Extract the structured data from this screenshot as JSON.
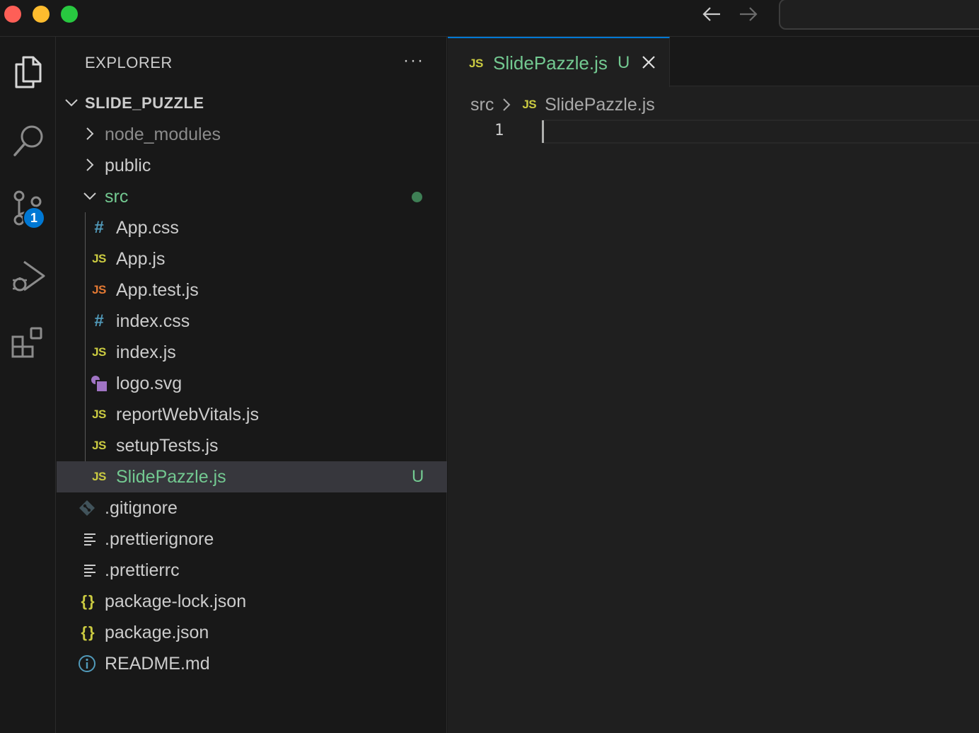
{
  "window": {
    "traffic_lights": {
      "close": "#fe5f57",
      "minimize": "#febc2e",
      "maximize": "#28c840"
    }
  },
  "activity_bar": {
    "items": [
      {
        "icon": "files-icon"
      },
      {
        "icon": "search-icon"
      },
      {
        "icon": "source-control-icon",
        "badge": "1"
      },
      {
        "icon": "run-debug-icon"
      },
      {
        "icon": "extensions-icon"
      }
    ]
  },
  "sidebar": {
    "title": "EXPLORER",
    "more_actions": "···",
    "folder": "SLIDE_PUZZLE",
    "tree": [
      {
        "label": "node_modules",
        "type": "folder",
        "expanded": false,
        "color": "#8b8b8b"
      },
      {
        "label": "public",
        "type": "folder",
        "expanded": false,
        "color": "#cccccc"
      },
      {
        "label": "src",
        "type": "folder",
        "expanded": true,
        "color": "#73c991",
        "modified_dot": "#3e7f55"
      },
      {
        "label": "App.css",
        "icon": "css-icon",
        "glyph": "#"
      },
      {
        "label": "App.js",
        "icon": "js-icon",
        "glyph": "JS"
      },
      {
        "label": "App.test.js",
        "icon": "js-test-icon",
        "glyph": "JS"
      },
      {
        "label": "index.css",
        "icon": "css-icon",
        "glyph": "#"
      },
      {
        "label": "index.js",
        "icon": "js-icon",
        "glyph": "JS"
      },
      {
        "label": "logo.svg",
        "icon": "svg-icon"
      },
      {
        "label": "reportWebVitals.js",
        "icon": "js-icon",
        "glyph": "JS"
      },
      {
        "label": "setupTests.js",
        "icon": "js-icon",
        "glyph": "JS"
      },
      {
        "label": "SlidePazzle.js",
        "icon": "js-icon",
        "glyph": "JS",
        "status": "U",
        "selected": true
      },
      {
        "label": ".gitignore",
        "icon": "git-icon"
      },
      {
        "label": ".prettierignore",
        "icon": "text-lines-icon"
      },
      {
        "label": ".prettierrc",
        "icon": "text-lines-icon"
      },
      {
        "label": "package-lock.json",
        "icon": "json-icon",
        "glyph": "{}"
      },
      {
        "label": "package.json",
        "icon": "json-icon",
        "glyph": "{}"
      },
      {
        "label": "README.md",
        "icon": "info-icon"
      }
    ]
  },
  "editor": {
    "tab": {
      "glyph": "JS",
      "label": "SlidePazzle.js",
      "status": "U"
    },
    "breadcrumb": {
      "folder": "src",
      "glyph": "JS",
      "file": "SlidePazzle.js"
    },
    "line_numbers": [
      "1"
    ]
  },
  "colors": {
    "accent": "#0078d4",
    "untracked": "#73c991",
    "js_icon": "#cbcb41",
    "css_icon": "#519aba",
    "test_icon": "#e37933"
  }
}
